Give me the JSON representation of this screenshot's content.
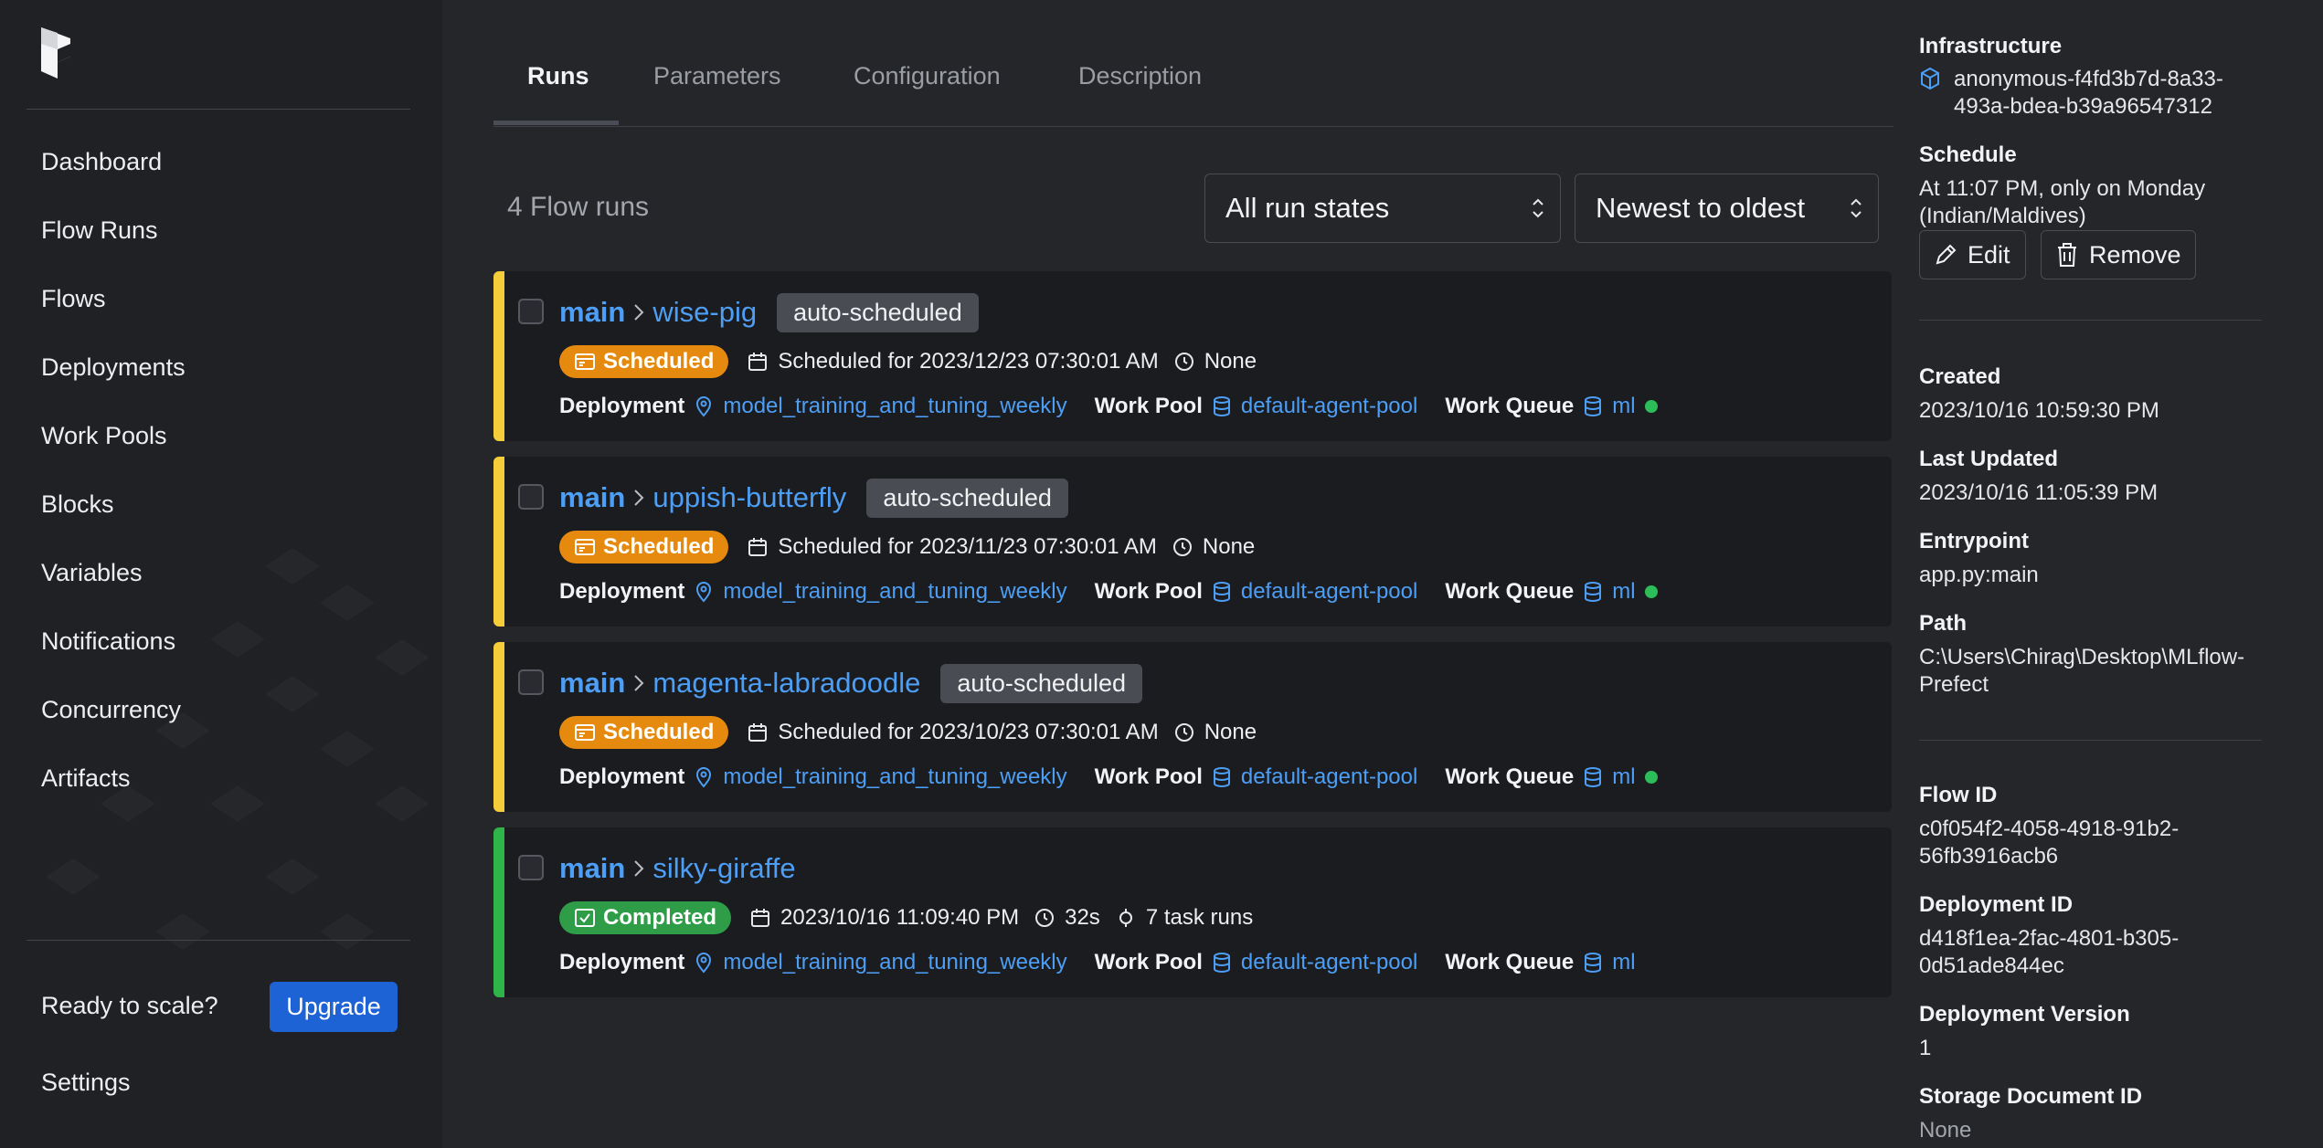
{
  "nav": {
    "items": [
      "Dashboard",
      "Flow Runs",
      "Flows",
      "Deployments",
      "Work Pools",
      "Blocks",
      "Variables",
      "Notifications",
      "Concurrency",
      "Artifacts"
    ],
    "ready_text": "Ready to scale?",
    "upgrade_label": "Upgrade",
    "settings_label": "Settings"
  },
  "tabs": [
    "Runs",
    "Parameters",
    "Configuration",
    "Description"
  ],
  "runs_count": "4 Flow runs",
  "filters": {
    "state": "All run states",
    "sort": "Newest to oldest"
  },
  "labels": {
    "deployment": "Deployment",
    "work_pool": "Work Pool",
    "work_queue": "Work Queue"
  },
  "runs": [
    {
      "flow": "main",
      "name": "wise-pig",
      "tag": "auto-scheduled",
      "state": "Scheduled",
      "date": "Scheduled for 2023/12/23 07:30:01 AM",
      "duration": "None",
      "deployment": "model_training_and_tuning_weekly",
      "work_pool": "default-agent-pool",
      "work_queue": "ml"
    },
    {
      "flow": "main",
      "name": "uppish-butterfly",
      "tag": "auto-scheduled",
      "state": "Scheduled",
      "date": "Scheduled for 2023/11/23 07:30:01 AM",
      "duration": "None",
      "deployment": "model_training_and_tuning_weekly",
      "work_pool": "default-agent-pool",
      "work_queue": "ml"
    },
    {
      "flow": "main",
      "name": "magenta-labradoodle",
      "tag": "auto-scheduled",
      "state": "Scheduled",
      "date": "Scheduled for 2023/10/23 07:30:01 AM",
      "duration": "None",
      "deployment": "model_training_and_tuning_weekly",
      "work_pool": "default-agent-pool",
      "work_queue": "ml"
    },
    {
      "flow": "main",
      "name": "silky-giraffe",
      "state": "Completed",
      "date": "2023/10/16 11:09:40 PM",
      "duration": "32s",
      "task_runs": "7 task runs",
      "deployment": "model_training_and_tuning_weekly",
      "work_pool": "default-agent-pool",
      "work_queue": "ml"
    }
  ],
  "details": {
    "infrastructure_label": "Infrastructure",
    "infrastructure_line1": "anonymous-f4fd3b7d-8a33-",
    "infrastructure_line2": "493a-bdea-b39a96547312",
    "schedule_label": "Schedule",
    "schedule_line1": "At 11:07 PM, only on Monday",
    "schedule_line2": "(Indian/Maldives)",
    "edit_label": "Edit",
    "remove_label": "Remove",
    "created_label": "Created",
    "created": "2023/10/16 10:59:30 PM",
    "updated_label": "Last Updated",
    "updated": "2023/10/16 11:05:39 PM",
    "entrypoint_label": "Entrypoint",
    "entrypoint": "app.py:main",
    "path_label": "Path",
    "path_line1": "C:\\Users\\Chirag\\Desktop\\MLflow-",
    "path_line2": "Prefect",
    "flow_id_label": "Flow ID",
    "flow_id_line1": "c0f054f2-4058-4918-91b2-",
    "flow_id_line2": "56fb3916acb6",
    "deployment_id_label": "Deployment ID",
    "deployment_id_line1": "d418f1ea-2fac-4801-b305-",
    "deployment_id_line2": "0d51ade844ec",
    "deployment_version_label": "Deployment Version",
    "deployment_version": "1",
    "storage_label": "Storage Document ID",
    "storage": "None"
  },
  "colors": {
    "accent": "#4d9ef5",
    "scheduled": "#e58a0e",
    "completed": "#2f9d48",
    "scheduled_bar": "#f5cc3a",
    "completed_bar": "#2fb44a",
    "upgrade": "#1e63d6"
  },
  "icons": [
    "prefect-logo",
    "calendar-icon",
    "clock-icon",
    "status-scheduled-icon",
    "status-completed-icon",
    "location-pin-icon",
    "database-icon",
    "task-runs-icon",
    "cube-icon",
    "pencil-icon",
    "trash-icon",
    "chevron-right-icon",
    "select-chevron-icon"
  ]
}
